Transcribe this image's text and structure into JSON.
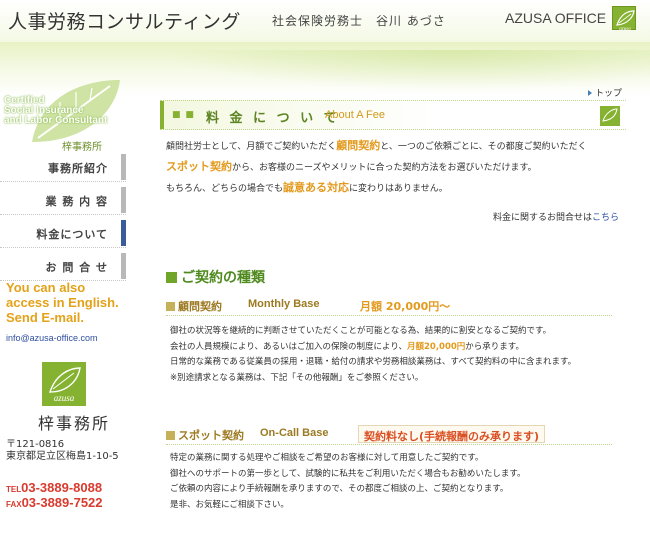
{
  "header": {
    "title": "人事労務コンサルティング",
    "subtitle": "社会保険労務士　谷川 あづさ",
    "office": "AZUSA OFFICE",
    "logo_text": "azusa"
  },
  "sidebar": {
    "leaf_lines": [
      "Certified",
      "Social Insurance",
      "and Labor Consultant"
    ],
    "leaf_sub": "梓事務所",
    "nav": [
      {
        "label": "事務所紹介"
      },
      {
        "label": "業 務 内 容"
      },
      {
        "label": "料金について"
      },
      {
        "label": "お 問 合 せ"
      }
    ],
    "english_lines": [
      "You can also",
      "access in English.",
      "Send E-mail."
    ],
    "email": "info@azusa-office.com",
    "logo_text": "azusa",
    "office_name": "梓事務所",
    "postal": "〒121-0816",
    "address": "東京都足立区梅島1-10-5",
    "tel_label": "TEL",
    "tel": "03-3889-8088",
    "fax_label": "FAX",
    "fax": "03-3889-7522"
  },
  "main": {
    "top_link": "トップ",
    "section_title_jp": "料 金 に つ い て",
    "section_title_en": "About A Fee",
    "intro": {
      "l1a": "顧問社労士として、月額でご契約いただく",
      "l1b": "顧問契約",
      "l1c": "と、一つのご依頼ごとに、その都度ご契約いただく",
      "l2a": "スポット契約",
      "l2b": "から、お客様のニーズやメリットに合った契約方法をお選びいただけます。",
      "l3a": "もちろん、どちらの場合でも",
      "l3b": "誠意ある対応",
      "l3c": "に変わりはありません。"
    },
    "inquiry_text": "料金に関するお問合せは",
    "inquiry_link": "こちら",
    "contracts_title": "ご契約の種類",
    "plan1": {
      "name": "顧問契約",
      "name_en": "Monthly Base",
      "price": "月額 20,000円～",
      "line1": "御社の状況等を継続的に判断させていただくことが可能となる為、結果的に割安となるご契約です。",
      "line2a": "会社の人員規模により、あるいはご加入の保険の制度により、",
      "line2b": "月額20,000円",
      "line2c": "から承ります。",
      "line3": "日常的な業務である従業員の採用・退職・給付の請求や労務相談業務は、すべて契約料の中に含まれます。",
      "line4": "※別途請求となる業務は、下記「その他報酬」をご参照ください。"
    },
    "plan2": {
      "name": "スポット契約",
      "name_en": "On-Call Base",
      "price": "契約料なし(手続報酬のみ承ります)",
      "line1": "特定の業務に関する処理やご相談をご希望のお客様に対して用意したご契約です。",
      "line2": "御社へのサポートの第一歩として、試験的に私共をご利用いただく場合もお勧めいたします。",
      "line3": "ご依頼の内容により手続報酬を承りますので、その都度ご相談の上、ご契約となります。",
      "line4": "是非、お気軽にご相談下さい。"
    }
  },
  "colors": {
    "accent_green": "#86b231",
    "accent_orange": "#e39a1d",
    "accent_red": "#d94f22",
    "nav_active": "#3a5c9a"
  }
}
